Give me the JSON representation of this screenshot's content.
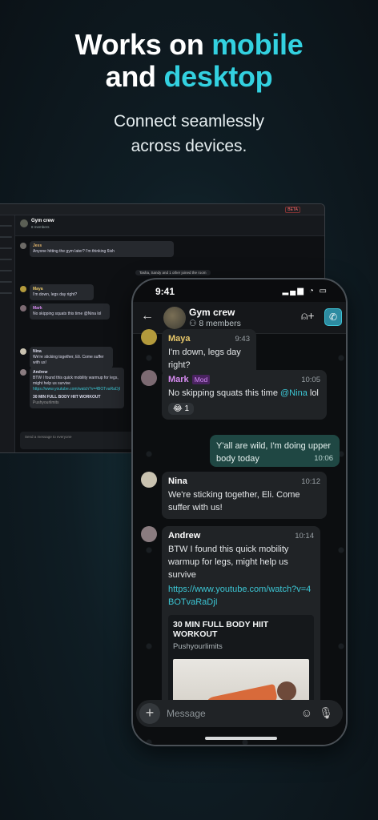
{
  "hero": {
    "line1_pre": "Works on ",
    "line1_accent": "mobile",
    "line2_pre": "and ",
    "line2_accent": "desktop",
    "subtitle_1": "Connect seamlessly",
    "subtitle_2": "across devices."
  },
  "desktop": {
    "beta": "BETA",
    "group_title": "Gym crew",
    "group_sub": "8 members",
    "jess_name": "Jess",
    "jess_text": "Anyone hitting the gym later? I'm thinking 6ish",
    "joined_note": "Tasha, Sandy and 1 other joined the room",
    "maya_name": "Maya",
    "maya_text": "I'm down, legs day right?",
    "mark_name": "Mark",
    "mark_text": "No skipping squats this time @Nina lol",
    "nina_name": "Nina",
    "nina_text": "We're sticking together, Eli. Come suffer with us!",
    "andrew_name": "Andrew",
    "andrew_text": "BTW I found this quick mobility warmup for legs, might help us survive",
    "andrew_link": "https://www.youtube.com/watch?v=4BOTvaRaDjI",
    "preview_title": "30 MIN FULL BODY HIIT WORKOUT",
    "preview_sub": "Pushyourlimits",
    "input_placeholder": "Send a message to everyone"
  },
  "phone": {
    "time": "9:41",
    "status_icons": "▂▄▆ ◔ ▭",
    "header": {
      "back_icon": "←",
      "title": "Gym crew",
      "members": "8 members",
      "add_icon": "⍝+",
      "call_icon": "✆"
    },
    "messages": [
      {
        "name": "Maya",
        "time": "9:43",
        "text": "I'm down, legs day right?",
        "color": "#e8c86a"
      },
      {
        "name": "Mark",
        "badge": "Mod",
        "time": "10:05",
        "text_pre": "No skipping squats this time ",
        "mention": "@Nina",
        "text_post": " lol",
        "reaction": "😂 1",
        "color": "#d68bf0"
      },
      {
        "own": true,
        "text": "Y'all are wild, I'm doing upper body today",
        "time": "10:06"
      },
      {
        "name": "Nina",
        "time": "10:12",
        "text": "We're sticking together, Eli. Come suffer with us!"
      },
      {
        "name": "Andrew",
        "time": "10:14",
        "text": "BTW I found this quick mobility warmup for legs, might help us survive",
        "link": "https://www.youtube.com/watch?v=4BOTvaRaDjI",
        "preview_title": "30 MIN FULL BODY HIIT WORKOUT",
        "preview_sub": "Pushyourlimits"
      }
    ],
    "composer": {
      "plus_icon": "+",
      "placeholder": "Message",
      "emoji_icon": "☺",
      "mic_icon": "🎙"
    }
  }
}
